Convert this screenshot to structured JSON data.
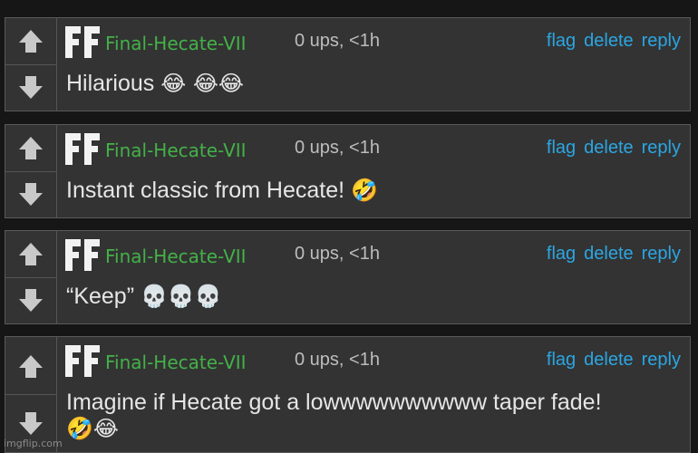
{
  "comments": [
    {
      "username": "Final-Hecate-VII",
      "meta": "0 ups, <1h",
      "actions": [
        "flag",
        "delete",
        "reply"
      ],
      "text": "Hilarious",
      "emoji": "😂  😂😂"
    },
    {
      "username": "Final-Hecate-VII",
      "meta": "0 ups, <1h",
      "actions": [
        "flag",
        "delete",
        "reply"
      ],
      "text": "Instant classic from Hecate!",
      "emoji": "🤣"
    },
    {
      "username": "Final-Hecate-VII",
      "meta": "0 ups, <1h",
      "actions": [
        "flag",
        "delete",
        "reply"
      ],
      "text": "“Keep”",
      "emoji": "💀💀💀"
    },
    {
      "username": "Final-Hecate-VII",
      "meta": "0 ups, <1h",
      "actions": [
        "flag",
        "delete",
        "reply"
      ],
      "text": "Imagine if Hecate got a lowwwwwwwwww taper fade!",
      "emoji": "🤣😂"
    }
  ],
  "watermark": "imgflip.com",
  "colors": {
    "username": "#43b148",
    "action_link": "#2ba6e3",
    "meta": "#bdbdbd",
    "comment_bg": "#333333",
    "page_bg": "#161616"
  },
  "icons": {
    "upvote": "arrow-up-icon",
    "downvote": "arrow-down-icon",
    "avatar": "ff-avatar-icon"
  }
}
